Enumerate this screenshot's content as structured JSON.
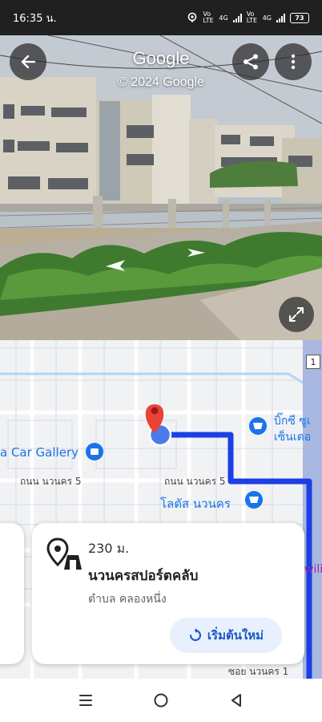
{
  "status_bar": {
    "time": "16:35 น.",
    "sim1_label": "Vo LTE",
    "network1": "4G",
    "sim2_label": "Vo LTE",
    "network2": "4G",
    "battery": "73"
  },
  "street_view": {
    "title": "Google",
    "copyright": "© 2024 Google"
  },
  "map": {
    "labels": {
      "car_gallery": "a Car Gallery",
      "big_c": "บิ๊กซี ซูเ",
      "big_c_line2": "เซ็นเตอ",
      "road_left": "ถนน นวนคร 5",
      "road_right": "ถนน นวนคร 5",
      "lotus": "โลตัส นวนคร",
      "right_edge": "wilic",
      "road_bottom": "ซอย นวนคร 1",
      "route_badge": "1"
    },
    "colors": {
      "route": "#1b3fe4",
      "pin": "#ea4335",
      "poi": "#1a73e8",
      "street_name": "#444444"
    }
  },
  "place_card": {
    "distance": "230 ม.",
    "name": "นวนครสปอร์ตคลับ",
    "subdistrict": "ตำบล คลองหนึ่ง",
    "restart_label": "เริ่มต้นใหม่"
  }
}
